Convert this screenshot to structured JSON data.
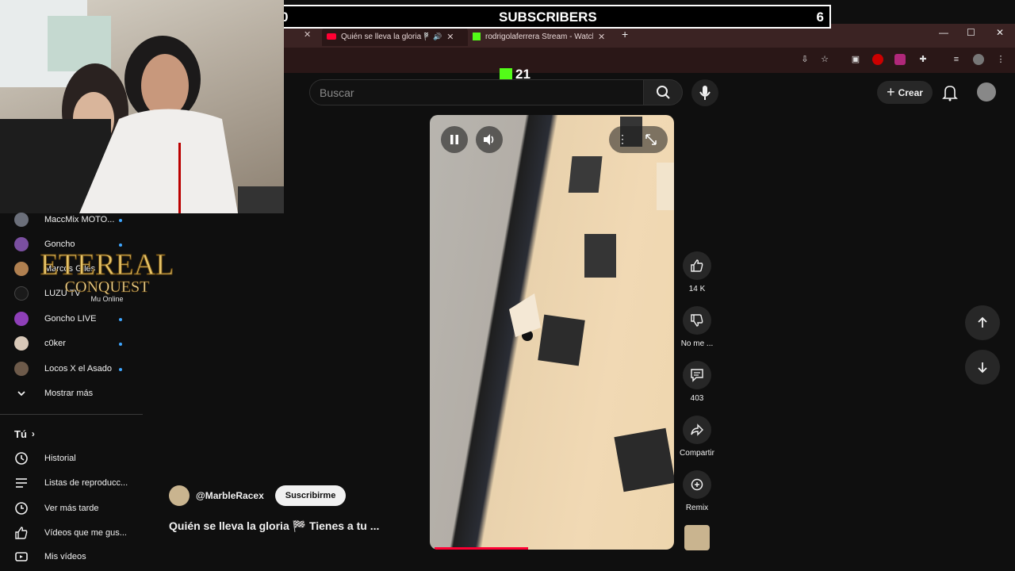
{
  "overlay": {
    "subscribers_left": "0",
    "subscribers_title": "SUBSCRIBERS",
    "subscribers_right": "6",
    "kick_viewers": "21"
  },
  "browser": {
    "tabs": [
      {
        "title": "Quién se lleva la gloria 🏁",
        "icon": "youtube-icon",
        "active": true
      },
      {
        "title": "rodrigolaferrera Stream - Watch",
        "icon": "kick-icon",
        "active": false
      }
    ],
    "new_tab": "+",
    "window": {
      "minimize": "—",
      "maximize": "☐",
      "close": "✕"
    }
  },
  "youtube": {
    "search_placeholder": "Buscar",
    "create_label": "Crear"
  },
  "sidebar": {
    "subscriptions": [
      {
        "name": "MaccMix MOTO...",
        "color": "#6b6f7a",
        "live": true
      },
      {
        "name": "Goncho",
        "color": "#7a4fa0",
        "live": true
      },
      {
        "name": "Marcos Giles",
        "color": "#b08050",
        "live": false
      },
      {
        "name": "LUZU TV",
        "color": "#1a1a1a",
        "live": false
      },
      {
        "name": "Goncho LIVE",
        "color": "#8e3fb8",
        "live": true
      },
      {
        "name": "c0ker",
        "color": "#d8c8b8",
        "live": true
      },
      {
        "name": "Locos X el Asado",
        "color": "#6d5a4a",
        "live": true
      }
    ],
    "show_more": "Mostrar más",
    "you_section": "Tú",
    "you_items": [
      {
        "label": "Historial",
        "icon": "history-icon"
      },
      {
        "label": "Listas de reproducc...",
        "icon": "playlist-icon"
      },
      {
        "label": "Ver más tarde",
        "icon": "watch-later-icon"
      },
      {
        "label": "Vídeos que me gus...",
        "icon": "like-icon"
      },
      {
        "label": "Mis vídeos",
        "icon": "my-videos-icon"
      }
    ]
  },
  "logo": {
    "line1": "ETEREAL",
    "line2": "CONQUEST",
    "line3": "Mu Online"
  },
  "short": {
    "channel": "@MarbleRacex",
    "subscribe_label": "Suscribirme",
    "title": "Quién se lleva la gloria 🏁 Tienes a tu ...",
    "progress": 0.4,
    "actions": {
      "like_count": "14 K",
      "dislike_label": "No me ...",
      "comments_count": "403",
      "share_label": "Compartir",
      "remix_label": "Remix"
    }
  },
  "colors": {
    "accent_red": "#ff0033",
    "live_dot": "#3ea6ff",
    "kick_green": "#53fc18"
  }
}
